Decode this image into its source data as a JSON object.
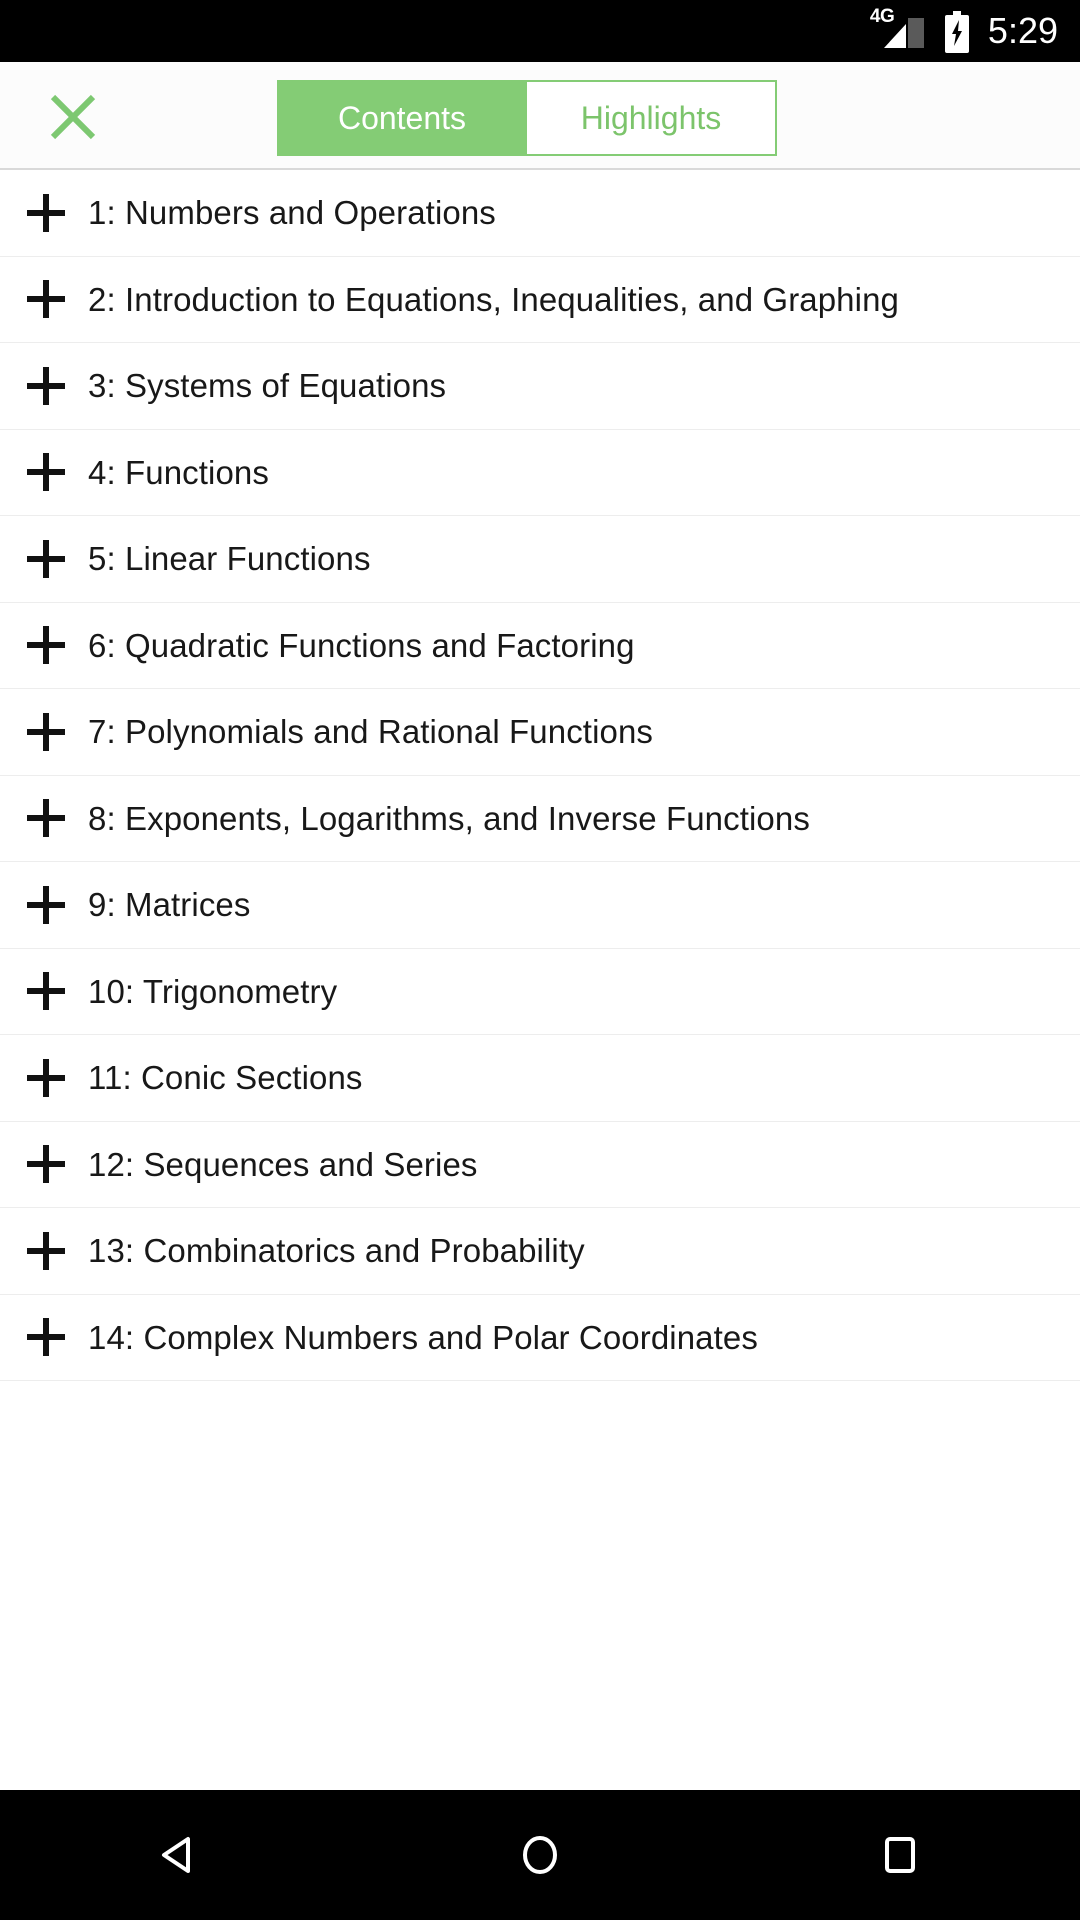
{
  "status_bar": {
    "network_label": "4G",
    "signal_icon": "signal-bars-icon",
    "battery_icon": "battery-charging-icon",
    "time": "5:29"
  },
  "header": {
    "close_icon": "close-x-icon",
    "accent_color": "#84cc75",
    "tabs": [
      {
        "label": "Contents",
        "active": true
      },
      {
        "label": "Highlights",
        "active": false
      }
    ]
  },
  "contents": {
    "expand_icon": "plus-icon",
    "items": [
      {
        "label": "1: Numbers and Operations"
      },
      {
        "label": "2: Introduction to Equations, Inequalities, and Graphing"
      },
      {
        "label": "3: Systems of Equations"
      },
      {
        "label": "4: Functions"
      },
      {
        "label": "5: Linear Functions"
      },
      {
        "label": "6: Quadratic Functions and Factoring"
      },
      {
        "label": "7: Polynomials and Rational Functions"
      },
      {
        "label": "8: Exponents, Logarithms, and Inverse Functions"
      },
      {
        "label": "9: Matrices"
      },
      {
        "label": "10: Trigonometry"
      },
      {
        "label": "11: Conic Sections"
      },
      {
        "label": "12: Sequences and Series"
      },
      {
        "label": "13: Combinatorics and Probability"
      },
      {
        "label": "14: Complex Numbers and Polar Coordinates"
      }
    ]
  },
  "nav_bar": {
    "back_icon": "back-triangle-icon",
    "home_icon": "home-circle-icon",
    "recents_icon": "recents-square-icon"
  }
}
